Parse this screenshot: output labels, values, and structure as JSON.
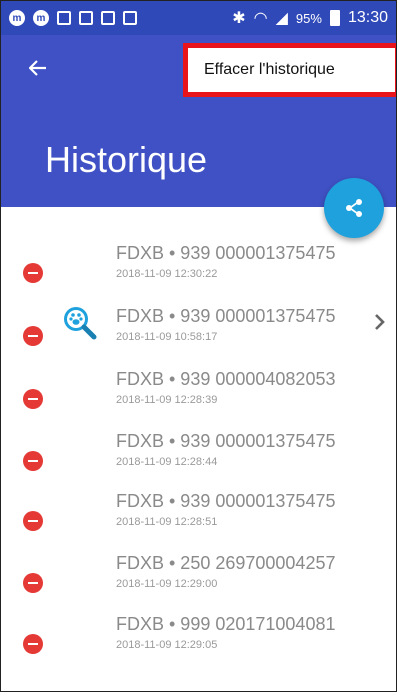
{
  "status_bar": {
    "battery_percent": "95%",
    "time": "13:30",
    "icons": [
      "app-m-icon",
      "app-m-icon",
      "video-icon",
      "screenshot-icon",
      "video-icon",
      "app-icon",
      "bluetooth-icon",
      "wifi-icon",
      "signal-icon",
      "battery-icon"
    ]
  },
  "appbar": {
    "back_icon": "arrow-left-icon",
    "title": "Historique",
    "menu_item": "Effacer l'historique",
    "share_icon": "share-icon"
  },
  "history": [
    {
      "title": "FDXB • 939 000001375475",
      "date": "2018-11-09 12:30:22"
    },
    {
      "title": "FDXB • 939 000001375475",
      "date": "2018-11-09 10:58:17",
      "has_pet_search": true,
      "has_chevron": true
    },
    {
      "title": "FDXB • 939 000004082053",
      "date": "2018-11-09 12:28:39"
    },
    {
      "title": "FDXB • 939 000001375475",
      "date": "2018-11-09 12:28:44"
    },
    {
      "title": "FDXB • 939 000001375475",
      "date": "2018-11-09 12:28:51"
    },
    {
      "title": "FDXB • 250 269700004257",
      "date": "2018-11-09 12:29:00"
    },
    {
      "title": "FDXB • 999 020171004081",
      "date": "2018-11-09 12:29:05"
    }
  ],
  "colors": {
    "status_bar": "#2f49b8",
    "app_bar": "#3f51c4",
    "fab": "#1ea1dc",
    "delete": "#e53935",
    "highlight_border": "#e8131b"
  }
}
